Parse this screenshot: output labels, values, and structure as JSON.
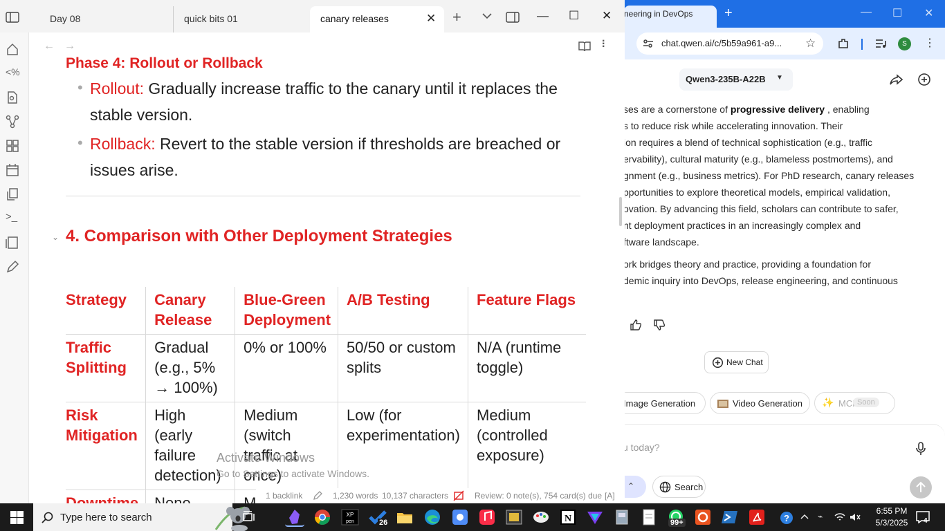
{
  "browser": {
    "tab_title": "neering in DevOps",
    "url": "chat.qwen.ai/c/5b59a961-a9...",
    "profile_initial": "S",
    "model": "Qwen3-235B-A22B",
    "answer_p1": [
      {
        "pre": "ses are a cornerstone of ",
        "bold": "progressive delivery",
        "post": " , enabling"
      },
      {
        "pre": "s to reduce risk while accelerating innovation. Their"
      },
      {
        "pre": "ion requires a blend of technical sophistication (e.g., traffic"
      },
      {
        "pre": "ervability), cultural maturity (e.g., blameless postmortems), and"
      },
      {
        "pre": "gnment (e.g., business metrics). For PhD research, canary releases"
      },
      {
        "pre": "pportunities to explore theoretical models, empirical validation,"
      },
      {
        "pre": "ovation. By advancing this field, scholars can contribute to safer,"
      },
      {
        "pre": "nt deployment practices in an increasingly complex and"
      },
      {
        "pre": "ftware landscape."
      }
    ],
    "answer_p2": [
      "ork bridges theory and practice, providing a foundation for",
      "demic inquiry into DevOps, release engineering, and continuous"
    ],
    "new_chat": "New Chat",
    "chip_image": "Image Generation",
    "chip_video": "Video Generation",
    "chip_mcp": "MCP",
    "chip_soon": "Soon",
    "input_placeholder": "u today?",
    "search_label": "Search",
    "activate_title": "Activate Windows",
    "activate_sub": "Go to Settings to activate Windows."
  },
  "notes": {
    "tabs": [
      "Day 08",
      "quick bits 01",
      "canary releases"
    ],
    "phase_heading": "Phase 4: Rollout or Rollback",
    "bullets": [
      {
        "term": "Rollout:",
        "text": " Gradually increase traffic to the canary until it replaces the stable version."
      },
      {
        "term": "Rollback:",
        "text": " Revert to the stable version if thresholds are breached or issues arise."
      }
    ],
    "section_heading": "4. Comparison with Other Deployment Strategies",
    "table": {
      "headers": [
        "Strategy",
        "Canary Release",
        "Blue-Green Deployment",
        "A/B Testing",
        "Feature Flags"
      ],
      "rows": [
        [
          "Traffic Splitting",
          "Gradual (e.g., 5% → 100%)",
          "0% or 100%",
          "50/50 or custom splits",
          "N/A (runtime toggle)"
        ],
        [
          "Risk Mitigation",
          "High (early failure detection)",
          "Medium (switch traffic at once)",
          "Low (for experimentation)",
          "Medium (controlled exposure)"
        ],
        [
          "Downtime",
          "None",
          "Mi",
          "",
          ""
        ]
      ]
    },
    "status": {
      "backlinks": "1 backlink",
      "words": "1,230 words",
      "chars": "10,137 characters",
      "review": "Review: 0 note(s), 754 card(s) due",
      "mode": "[A]"
    }
  },
  "taskbar": {
    "search_placeholder": "Type here to search",
    "badge_app": "26",
    "badge_whatsapp": "99+",
    "time": "6:55 PM",
    "date": "5/3/2025",
    "notifications": "4"
  },
  "colors": {
    "accent_red": "#e02424",
    "browser_blue": "#1f6fe5",
    "taskbar": "#1b1b1b"
  }
}
